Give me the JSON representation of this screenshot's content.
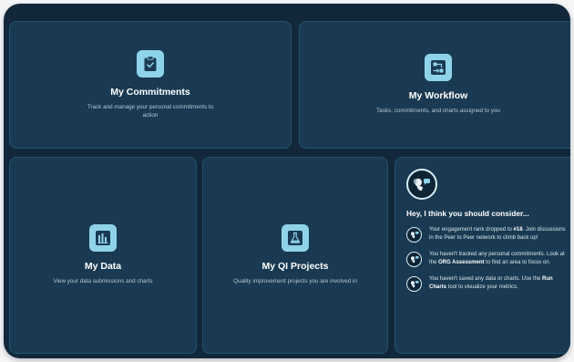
{
  "colors": {
    "background": "#12283a",
    "card": "#193a52",
    "accent": "#8fd3ea"
  },
  "cards": [
    {
      "title": "My Commitments",
      "description": "Track and manage your personal commitments to action",
      "icon": "clipboard-check-icon"
    },
    {
      "title": "My Workflow",
      "description": "Tasks, commitments, and charts assigned to you",
      "icon": "workflow-icon"
    },
    {
      "title": "My Data",
      "description": "View your data submissions and charts",
      "icon": "bar-chart-icon"
    },
    {
      "title": "My QI Projects",
      "description": "Quality improvement projects you are involved in",
      "icon": "flask-icon"
    }
  ],
  "suggestions": {
    "avatar_icon": "dog-mascot-icon",
    "heading": "Hey, I think you should consider...",
    "items": [
      {
        "icon": "mascot-icon",
        "pre": "Your engagement rank dropped to ",
        "bold": "#18",
        "post": ". Join discussions in the Peer to Peer network to climb back up!"
      },
      {
        "icon": "mascot-icon",
        "pre": "You haven't tracked any personal commitments. Look at the ",
        "bold": "ORG Assessment",
        "post": " to find an area to focus on."
      },
      {
        "icon": "mascot-icon",
        "pre": "You haven't saved any data or charts. Use the ",
        "bold": "Run Charts",
        "post": " tool to visualize your metrics."
      }
    ]
  }
}
